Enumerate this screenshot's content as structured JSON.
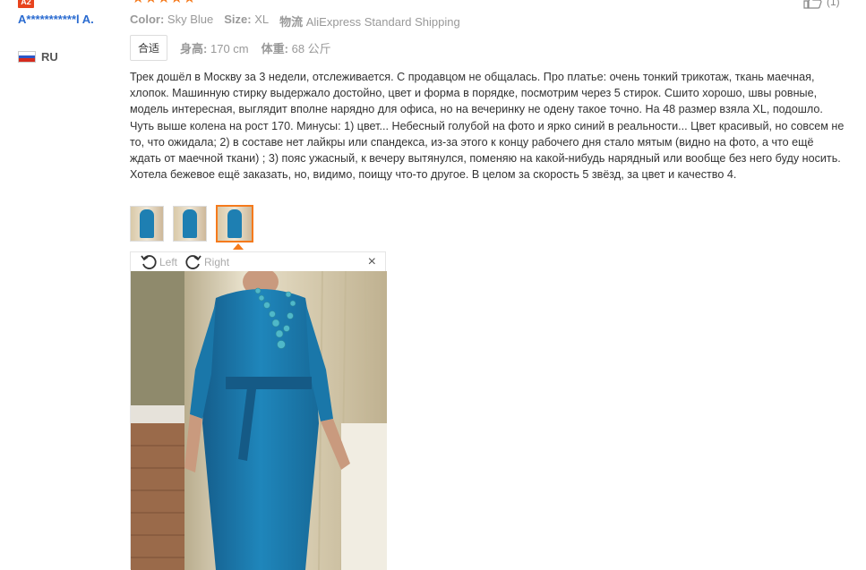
{
  "reviewer": {
    "badge": "A2",
    "name": "A***********l A.",
    "country_code": "RU"
  },
  "review": {
    "stars": "★★★★★",
    "rating": 5,
    "helpful_count": "(1)",
    "color_label": "Color:",
    "color_value": "Sky Blue",
    "size_label": "Size:",
    "size_value": "XL",
    "shipping_label": "物流",
    "shipping_value": "AliExpress Standard Shipping",
    "fit_tag": "合适",
    "height_label": "身高:",
    "height_value": "170 cm",
    "weight_label": "体重:",
    "weight_value": "68 公斤",
    "text": "Трек дошёл в Москву за 3 недели, отслеживается. С продавцом не общалась. Про платье: очень тонкий трикотаж, ткань маечная, хлопок. Машинную стирку выдержало достойно, цвет и форма в порядке, посмотрим через 5 стирок. Сшито хорошо, швы ровные, модель интересная, выглядит вполне нарядно для офиса, но на вечеринку не одену такое точно. На 48 размер взяла XL, подошло. Чуть выше колена на рост 170. Минусы: 1) цвет... Небесный голубой на фото и ярко синий в реальности... Цвет красивый, но совсем не то, что ожидала; 2) в составе нет лайкры или спандекса, из-за этого к концу рабочего дня стало мятым (видно на фото, а что ещё ждать от маечной ткани) ; 3) пояс ужасный, к вечеру вытянулся, поменяю на какой-нибудь нарядный или вообще без него буду носить. Хотела бежевое ещё заказать, но, видимо, поищу что-то другое. В целом за скорость 5 звёзд, за цвет и качество 4."
  },
  "viewer": {
    "rotate_left": "Left",
    "rotate_right": "Right",
    "close": "×",
    "thumbnail_count": 3,
    "active_thumbnail": 3
  },
  "colors": {
    "star": "#f57a1c",
    "username": "#2a6bd0",
    "badge": "#e8431d",
    "dress": "#1e7fb2"
  }
}
